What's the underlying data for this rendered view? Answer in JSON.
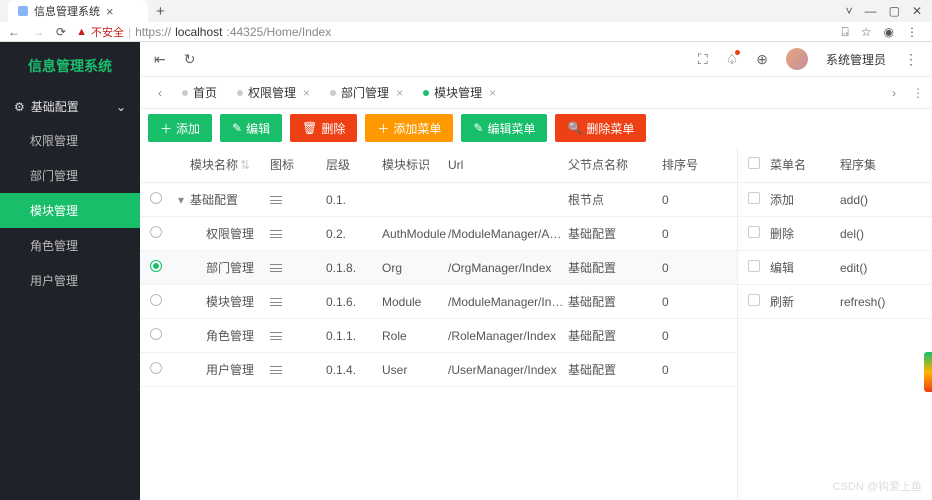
{
  "browser": {
    "tab_title": "信息管理系统",
    "url_warning": "不安全",
    "url_scheme": "https://",
    "url_host": "localhost",
    "url_port_path": ":44325/Home/Index"
  },
  "app": {
    "title": "信息管理系统",
    "user": "系统管理员"
  },
  "sidebar": {
    "group": "基础配置",
    "items": [
      "权限管理",
      "部门管理",
      "模块管理",
      "角色管理",
      "用户管理"
    ],
    "active_index": 2
  },
  "tabs": {
    "items": [
      {
        "label": "首页",
        "closable": false
      },
      {
        "label": "权限管理",
        "closable": true
      },
      {
        "label": "部门管理",
        "closable": true
      },
      {
        "label": "模块管理",
        "closable": true
      }
    ],
    "active_index": 3
  },
  "toolbar": {
    "add": "添加",
    "edit": "编辑",
    "delete": "删除",
    "add_menu": "添加菜单",
    "edit_menu": "编辑菜单",
    "delete_menu": "删除菜单"
  },
  "table": {
    "headers": {
      "name": "模块名称",
      "icon": "图标",
      "level": "层级",
      "ident": "模块标识",
      "url": "Url",
      "parent": "父节点名称",
      "sort": "排序号"
    },
    "rows": [
      {
        "expand": true,
        "name": "基础配置",
        "level": "0.1.",
        "ident": "",
        "url": "",
        "parent": "根节点",
        "sort": "0",
        "depth": 0
      },
      {
        "name": "权限管理",
        "level": "0.2.",
        "ident": "AuthModule",
        "url": "/ModuleManager/Auth/I...",
        "parent": "基础配置",
        "sort": "0",
        "depth": 1
      },
      {
        "selected": true,
        "name": "部门管理",
        "level": "0.1.8.",
        "ident": "Org",
        "url": "/OrgManager/Index",
        "parent": "基础配置",
        "sort": "0",
        "depth": 1
      },
      {
        "name": "模块管理",
        "level": "0.1.6.",
        "ident": "Module",
        "url": "/ModuleManager/Index",
        "parent": "基础配置",
        "sort": "0",
        "depth": 1
      },
      {
        "name": "角色管理",
        "level": "0.1.1.",
        "ident": "Role",
        "url": "/RoleManager/Index",
        "parent": "基础配置",
        "sort": "0",
        "depth": 1
      },
      {
        "name": "用户管理",
        "level": "0.1.4.",
        "ident": "User",
        "url": "/UserManager/Index",
        "parent": "基础配置",
        "sort": "0",
        "depth": 1
      }
    ]
  },
  "menu_table": {
    "headers": {
      "name": "菜单名",
      "proc": "程序集"
    },
    "rows": [
      {
        "name": "添加",
        "proc": "add()"
      },
      {
        "name": "删除",
        "proc": "del()"
      },
      {
        "name": "编辑",
        "proc": "edit()"
      },
      {
        "name": "刷新",
        "proc": "refresh()"
      }
    ]
  },
  "watermark": "CSDN @钩爱上鱼"
}
